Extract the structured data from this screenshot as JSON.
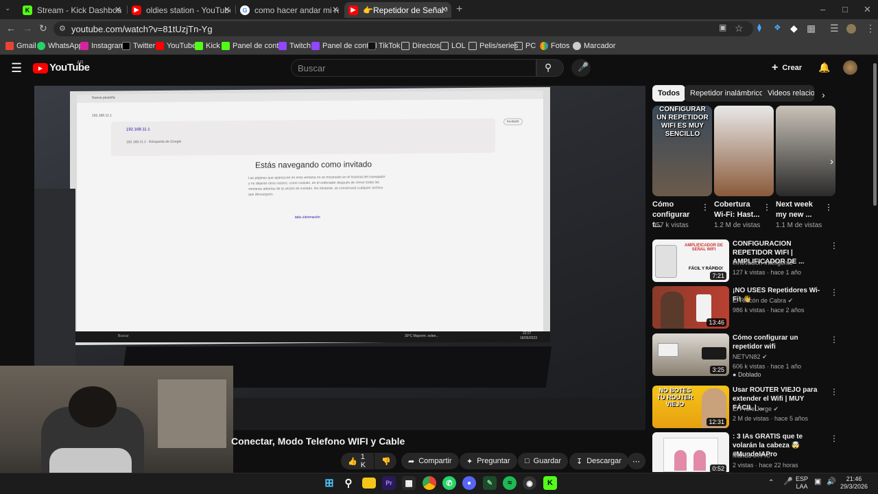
{
  "tabs": [
    {
      "label": "Stream - Kick Dashboard",
      "color": "#53fc18"
    },
    {
      "label": "oldies station - YouTube",
      "color": "#ff0000"
    },
    {
      "label": "como hacer andar mi repetidor",
      "color": "#4285f4"
    },
    {
      "label": "👉Repetidor de Señal WIFI, Co",
      "color": "#ff0000"
    }
  ],
  "address": {
    "url": "youtube.com/watch?v=81tUzjTn-Yg"
  },
  "bookmarks": [
    "Gmail",
    "WhatsApp",
    "Instagram",
    "Twitter",
    "YouTube",
    "Kick",
    "Panel de control",
    "Twitch",
    "Panel de control",
    "TikTok",
    "Directos",
    "LOL",
    "Pelis/series",
    "PC",
    "Fotos",
    "Marcador"
  ],
  "yt": {
    "logo": "YouTube",
    "region": "AR",
    "search_placeholder": "Buscar",
    "create": "Crear"
  },
  "video": {
    "screen_title": "Estás navegando como invitado",
    "screen_url": "192.168.11.1",
    "screen_search": "192.168.11.1 - Búsqueda de Google",
    "screen_badge": "Invitado",
    "screen_tab": "Nueva pestaña",
    "screen_body": "Las páginas que aparezcan en esta ventana no se mostrarán en el historial del navegador y no dejarán otros rastros, como cookies, en el ordenador después de cerrar todas las ventanas abiertas de la sesión de invitado. No obstante, se conservará cualquier archivo que descargues.",
    "screen_link": "Más información",
    "screen_search_box": "Buscar",
    "screen_status": "30°C  Mayorm. solee...",
    "screen_time": "22:27",
    "screen_date": "18/05/2023",
    "title": "Conectar, Modo Telefono WIFI y Cable",
    "likes": "1 K",
    "share": "Compartir",
    "ask": "Preguntar",
    "save": "Guardar",
    "download": "Descargar"
  },
  "chips": [
    "Todos",
    "Repetidor inalámbrico",
    "Videos relacio"
  ],
  "shorts": [
    {
      "title": "Cómo configurar t...",
      "views": "957 k vistas",
      "overlay": "CONFIGURAR UN REPETIDOR WIFI ES MUY SENCILLO"
    },
    {
      "title": "Cobertura Wi-Fi: Hast...",
      "views": "1.2 M de vistas"
    },
    {
      "title": "Next week my new ...",
      "views": "1.1 M de vistas"
    }
  ],
  "recommendations": [
    {
      "title": "CONFIGURACION REPETIDOR WIFI | AMPLIFICADOR DE ...",
      "channel": "Innovacion Inteligente",
      "meta": "127 k vistas · hace 1 año",
      "duration": "7:21",
      "badge": ""
    },
    {
      "title": "¡NO USES Repetidores Wi-Fi! 👋",
      "channel": "El Rincón de Cabra",
      "meta": "986 k vistas · hace 2 años",
      "duration": "13:46",
      "badge": ""
    },
    {
      "title": "Cómo configurar un repetidor wifi",
      "channel": "NETVN82",
      "meta": "606 k vistas · hace 1 año",
      "duration": "3:25",
      "badge": "Doblado"
    },
    {
      "title": "Usar ROUTER VIEJO para extender el Wifi | MUY FÁCIL | ...",
      "channel": "El Profe Jorge",
      "meta": "2 M de vistas · hace 5 años",
      "duration": "12:31",
      "badge": ""
    },
    {
      "title": ": 3 IAs GRATIS que te volarán la cabeza 🤯 #MundoIAPro",
      "channel": "Mundo IA Pro",
      "meta": "2 vistas · hace 22 horas",
      "duration": "0:52",
      "badge": ""
    }
  ],
  "rec_overlays": {
    "r1": "AMPLIFICADOR DE SEÑAL WIFI",
    "r1b": "FÁCIL Y RÁPIDO!",
    "r4": "NO BOTES TU ROUTER VIEJO"
  },
  "taskbar": {
    "lang": "ESP",
    "lang2": "LAA",
    "time": "21:46",
    "date": "29/3/2026"
  },
  "colors": {
    "yt_red": "#ff0000",
    "kick_green": "#53fc18",
    "bg": "#0f0f0f"
  }
}
